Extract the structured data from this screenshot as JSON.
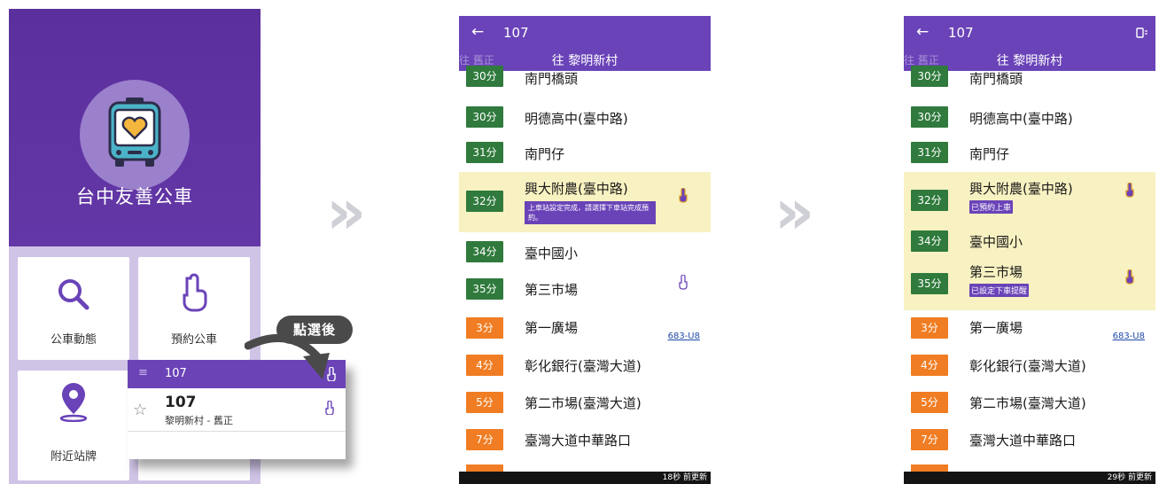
{
  "home": {
    "app_title": "台中友善公車",
    "tiles": {
      "bus_status": "公車動態",
      "reserve_bus": "預約公車",
      "nearby_stops": "附近站牌"
    }
  },
  "callout": {
    "label": "點選後"
  },
  "popup": {
    "bar_route": "107",
    "route_number": "107",
    "route_desc": "黎明新村 - 舊正"
  },
  "screen2": {
    "route_number": "107",
    "direction_old": "往 舊正",
    "direction_title": "往 黎明新村",
    "stops": [
      {
        "eta": "30分",
        "name": "南門橋頭",
        "color": "green"
      },
      {
        "eta": "30分",
        "name": "明德高中(臺中路)",
        "color": "green"
      },
      {
        "eta": "31分",
        "name": "南門仔",
        "color": "green"
      },
      {
        "eta": "32分",
        "name": "興大附農(臺中路)",
        "color": "green",
        "message": "上車站設定完成，請選擇下車站完成預約。"
      },
      {
        "eta": "34分",
        "name": "臺中國小",
        "color": "green"
      },
      {
        "eta": "35分",
        "name": "第三市場",
        "color": "green"
      },
      {
        "eta": "3分",
        "name": "第一廣場",
        "color": "orange",
        "route_link": "683-U8"
      },
      {
        "eta": "4分",
        "name": "彰化銀行(臺灣大道)",
        "color": "orange"
      },
      {
        "eta": "5分",
        "name": "第二市場(臺灣大道)",
        "color": "orange"
      },
      {
        "eta": "7分",
        "name": "臺灣大道中華路口",
        "color": "orange"
      }
    ],
    "update_text": "18秒 前更新"
  },
  "screen3": {
    "route_number": "107",
    "direction_old": "往 舊正",
    "direction_title": "往 黎明新村",
    "stops": [
      {
        "eta": "30分",
        "name": "南門橋頭",
        "color": "green"
      },
      {
        "eta": "30分",
        "name": "明德高中(臺中路)",
        "color": "green"
      },
      {
        "eta": "31分",
        "name": "南門仔",
        "color": "green"
      },
      {
        "eta": "32分",
        "name": "興大附農(臺中路)",
        "color": "green",
        "status": "已預約上車"
      },
      {
        "eta": "34分",
        "name": "臺中國小",
        "color": "green"
      },
      {
        "eta": "35分",
        "name": "第三市場",
        "color": "green",
        "status": "已設定下車提醒"
      },
      {
        "eta": "3分",
        "name": "第一廣場",
        "color": "orange",
        "route_link": "683-U8"
      },
      {
        "eta": "4分",
        "name": "彰化銀行(臺灣大道)",
        "color": "orange"
      },
      {
        "eta": "5分",
        "name": "第二市場(臺灣大道)",
        "color": "orange"
      },
      {
        "eta": "7分",
        "name": "臺灣大道中華路口",
        "color": "orange"
      }
    ],
    "update_text": "29秒 前更新"
  },
  "colors": {
    "brand_purple": "#6a43b8",
    "eta_green": "#2f7a3c",
    "eta_orange": "#f07d23",
    "highlight_yellow": "#f8f1c1"
  }
}
